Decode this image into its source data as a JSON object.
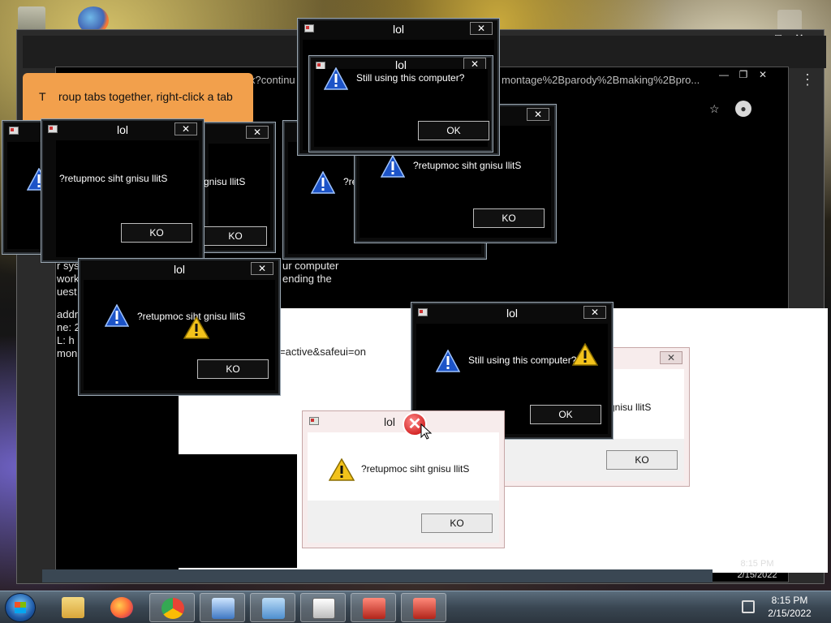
{
  "desktop": {
    "colors": {
      "taskbar": "#3a4753",
      "dialog_dark_bg": "#0b0b0b",
      "dialog_light_bg": "#f7ecec",
      "tooltip": "#f2a04c"
    }
  },
  "browser": {
    "url_left": "x?continu",
    "url_right": "montage%2Bparody%2Bmaking%2Bpro...",
    "tooltip_text": "roup tabs together, right-click a tab",
    "tooltip_lead": "T",
    "page_text": {
      "line1": "ur computer",
      "line2": "ending the",
      "line3": "=active&safeui=on",
      "frag_a": "r sys",
      "frag_b": "work",
      "frag_c": "uest",
      "frag_d": "addr",
      "frag_e": "ne: 2",
      "frag_f": "L: h",
      "frag_g": "mon"
    }
  },
  "dialogs": [
    {
      "id": "d1",
      "title": "lol",
      "message": "Still using this computer?",
      "button": "OK"
    },
    {
      "id": "d2",
      "title": "lol",
      "message": "",
      "button": ""
    },
    {
      "id": "d3",
      "title": "lol",
      "message": "?retupmoc siht gnisu llitS",
      "button": "KO"
    },
    {
      "id": "d4",
      "title": "",
      "message": "?retupmoc siht gnisu llitS",
      "button": "KO"
    },
    {
      "id": "d5",
      "title": "",
      "message": "?re",
      "button": ""
    },
    {
      "id": "d6",
      "title": "",
      "message": "?retupmoc siht gnisu llitS",
      "button": "KO"
    },
    {
      "id": "d7",
      "title": "lol",
      "message": "?retupmoc siht gnisu llitS",
      "button": "KO"
    },
    {
      "id": "d8",
      "title": "lol",
      "message": "Still using this computer?",
      "button": "OK"
    },
    {
      "id": "d9",
      "title": "",
      "message": "?retupmoc siht gnisu llitS",
      "button": "KO"
    },
    {
      "id": "d10",
      "title": "lol",
      "message": "?retupmoc siht gnisu llitS",
      "button": "KO"
    }
  ],
  "misc_labels": {
    "d2_title_partial": "lol",
    "d9_partial": "gnisu llitS",
    "d5_msg_right": "gnisu llitS",
    "top_overlap_title": "lol"
  },
  "taskbar": {
    "clock_time": "8:15 PM",
    "clock_date": "2/15/2022",
    "ghost_time": "8:15 PM",
    "ghost_date": "2/15/2022",
    "apps": [
      {
        "name": "file-explorer",
        "color": "#e8c25a"
      },
      {
        "name": "firefox",
        "color": "#ff7139"
      },
      {
        "name": "chrome",
        "color": "#4285f4"
      },
      {
        "name": "computer-settings",
        "color": "#7fb2e5"
      },
      {
        "name": "control-panel",
        "color": "#5aa0d8"
      },
      {
        "name": "notepad-window",
        "color": "#cfcfcf"
      },
      {
        "name": "app-red-1",
        "color": "#c0392b"
      },
      {
        "name": "app-red-2",
        "color": "#c0392b"
      }
    ]
  }
}
